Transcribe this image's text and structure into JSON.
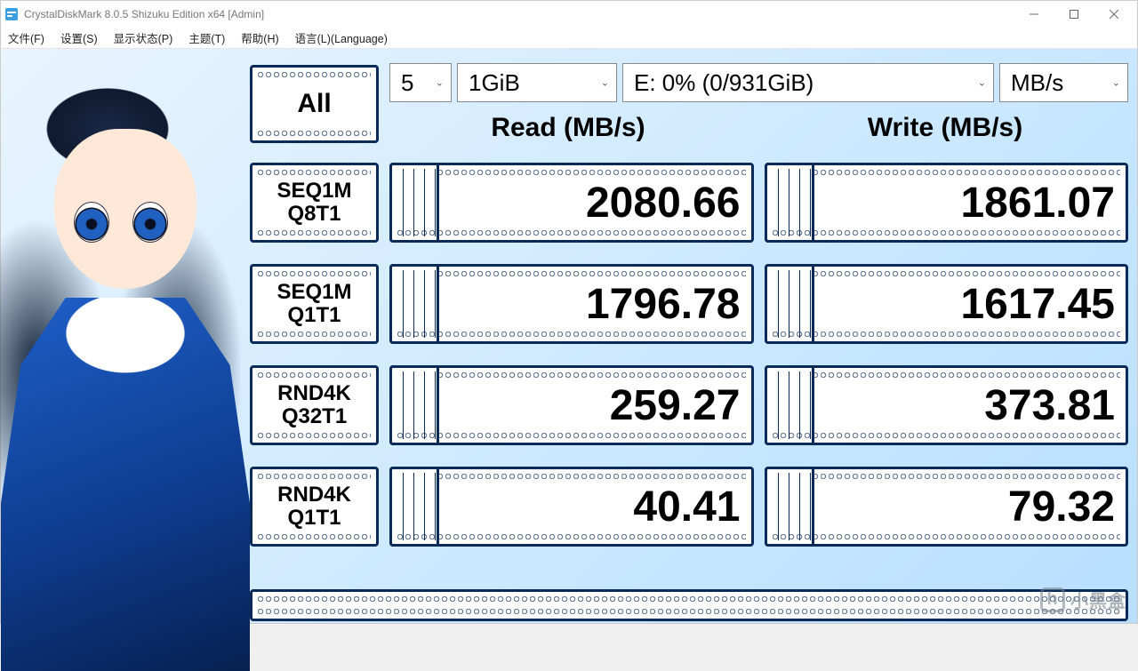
{
  "window": {
    "title": "CrystalDiskMark 8.0.5 Shizuku Edition x64 [Admin]"
  },
  "menu": {
    "file": "文件(F)",
    "settings": "设置(S)",
    "display": "显示状态(P)",
    "theme": "主题(T)",
    "help": "帮助(H)",
    "language": "语言(L)(Language)"
  },
  "controls": {
    "all_label": "All",
    "count_value": "5",
    "size_value": "1GiB",
    "drive_value": "E: 0% (0/931GiB)",
    "unit_value": "MB/s"
  },
  "headers": {
    "read": "Read (MB/s)",
    "write": "Write (MB/s)"
  },
  "tests": [
    {
      "label_line1": "SEQ1M",
      "label_line2": "Q8T1",
      "read": "2080.66",
      "write": "1861.07"
    },
    {
      "label_line1": "SEQ1M",
      "label_line2": "Q1T1",
      "read": "1796.78",
      "write": "1617.45"
    },
    {
      "label_line1": "RND4K",
      "label_line2": "Q32T1",
      "read": "259.27",
      "write": "373.81"
    },
    {
      "label_line1": "RND4K",
      "label_line2": "Q1T1",
      "read": "40.41",
      "write": "79.32"
    }
  ],
  "watermark": "小黑盒"
}
